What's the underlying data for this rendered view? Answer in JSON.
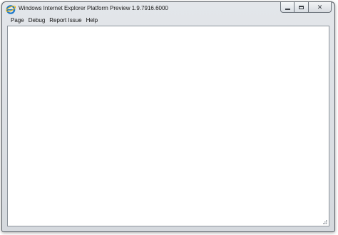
{
  "window": {
    "title": "Windows Internet Explorer Platform Preview 1.9.7916.6000",
    "app_icon": "ie-logo-icon",
    "controls": {
      "minimize": "minimize-icon",
      "maximize": "maximize-icon",
      "close": "close-icon"
    }
  },
  "menu": {
    "items": [
      {
        "label": "Page"
      },
      {
        "label": "Debug"
      },
      {
        "label": "Report Issue"
      },
      {
        "label": "Help"
      }
    ]
  },
  "colors": {
    "frame": "#d5d9de",
    "content_bg": "#ffffff",
    "ie_blue": "#1e78c8"
  }
}
